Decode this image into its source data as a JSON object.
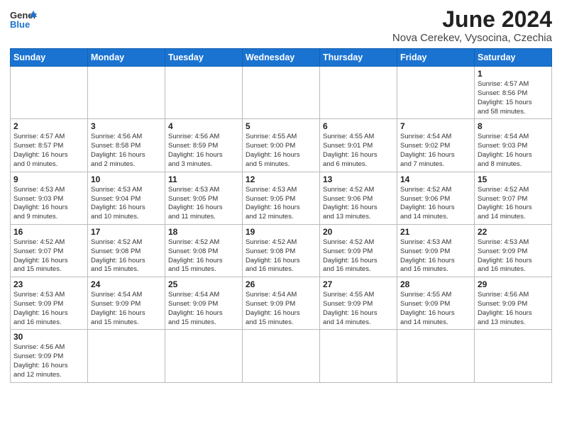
{
  "header": {
    "logo_general": "General",
    "logo_blue": "Blue",
    "month_title": "June 2024",
    "location": "Nova Cerekev, Vysocina, Czechia"
  },
  "days_of_week": [
    "Sunday",
    "Monday",
    "Tuesday",
    "Wednesday",
    "Thursday",
    "Friday",
    "Saturday"
  ],
  "weeks": [
    [
      {
        "day": "",
        "info": "",
        "empty": true
      },
      {
        "day": "",
        "info": "",
        "empty": true
      },
      {
        "day": "",
        "info": "",
        "empty": true
      },
      {
        "day": "",
        "info": "",
        "empty": true
      },
      {
        "day": "",
        "info": "",
        "empty": true
      },
      {
        "day": "",
        "info": "",
        "empty": true
      },
      {
        "day": "1",
        "info": "Sunrise: 4:57 AM\nSunset: 8:56 PM\nDaylight: 15 hours\nand 58 minutes.",
        "empty": false
      }
    ],
    [
      {
        "day": "2",
        "info": "Sunrise: 4:57 AM\nSunset: 8:57 PM\nDaylight: 16 hours\nand 0 minutes.",
        "empty": false
      },
      {
        "day": "3",
        "info": "Sunrise: 4:56 AM\nSunset: 8:58 PM\nDaylight: 16 hours\nand 2 minutes.",
        "empty": false
      },
      {
        "day": "4",
        "info": "Sunrise: 4:56 AM\nSunset: 8:59 PM\nDaylight: 16 hours\nand 3 minutes.",
        "empty": false
      },
      {
        "day": "5",
        "info": "Sunrise: 4:55 AM\nSunset: 9:00 PM\nDaylight: 16 hours\nand 5 minutes.",
        "empty": false
      },
      {
        "day": "6",
        "info": "Sunrise: 4:55 AM\nSunset: 9:01 PM\nDaylight: 16 hours\nand 6 minutes.",
        "empty": false
      },
      {
        "day": "7",
        "info": "Sunrise: 4:54 AM\nSunset: 9:02 PM\nDaylight: 16 hours\nand 7 minutes.",
        "empty": false
      },
      {
        "day": "8",
        "info": "Sunrise: 4:54 AM\nSunset: 9:03 PM\nDaylight: 16 hours\nand 8 minutes.",
        "empty": false
      }
    ],
    [
      {
        "day": "9",
        "info": "Sunrise: 4:53 AM\nSunset: 9:03 PM\nDaylight: 16 hours\nand 9 minutes.",
        "empty": false
      },
      {
        "day": "10",
        "info": "Sunrise: 4:53 AM\nSunset: 9:04 PM\nDaylight: 16 hours\nand 10 minutes.",
        "empty": false
      },
      {
        "day": "11",
        "info": "Sunrise: 4:53 AM\nSunset: 9:05 PM\nDaylight: 16 hours\nand 11 minutes.",
        "empty": false
      },
      {
        "day": "12",
        "info": "Sunrise: 4:53 AM\nSunset: 9:05 PM\nDaylight: 16 hours\nand 12 minutes.",
        "empty": false
      },
      {
        "day": "13",
        "info": "Sunrise: 4:52 AM\nSunset: 9:06 PM\nDaylight: 16 hours\nand 13 minutes.",
        "empty": false
      },
      {
        "day": "14",
        "info": "Sunrise: 4:52 AM\nSunset: 9:06 PM\nDaylight: 16 hours\nand 14 minutes.",
        "empty": false
      },
      {
        "day": "15",
        "info": "Sunrise: 4:52 AM\nSunset: 9:07 PM\nDaylight: 16 hours\nand 14 minutes.",
        "empty": false
      }
    ],
    [
      {
        "day": "16",
        "info": "Sunrise: 4:52 AM\nSunset: 9:07 PM\nDaylight: 16 hours\nand 15 minutes.",
        "empty": false
      },
      {
        "day": "17",
        "info": "Sunrise: 4:52 AM\nSunset: 9:08 PM\nDaylight: 16 hours\nand 15 minutes.",
        "empty": false
      },
      {
        "day": "18",
        "info": "Sunrise: 4:52 AM\nSunset: 9:08 PM\nDaylight: 16 hours\nand 15 minutes.",
        "empty": false
      },
      {
        "day": "19",
        "info": "Sunrise: 4:52 AM\nSunset: 9:08 PM\nDaylight: 16 hours\nand 16 minutes.",
        "empty": false
      },
      {
        "day": "20",
        "info": "Sunrise: 4:52 AM\nSunset: 9:09 PM\nDaylight: 16 hours\nand 16 minutes.",
        "empty": false
      },
      {
        "day": "21",
        "info": "Sunrise: 4:53 AM\nSunset: 9:09 PM\nDaylight: 16 hours\nand 16 minutes.",
        "empty": false
      },
      {
        "day": "22",
        "info": "Sunrise: 4:53 AM\nSunset: 9:09 PM\nDaylight: 16 hours\nand 16 minutes.",
        "empty": false
      }
    ],
    [
      {
        "day": "23",
        "info": "Sunrise: 4:53 AM\nSunset: 9:09 PM\nDaylight: 16 hours\nand 16 minutes.",
        "empty": false
      },
      {
        "day": "24",
        "info": "Sunrise: 4:54 AM\nSunset: 9:09 PM\nDaylight: 16 hours\nand 15 minutes.",
        "empty": false
      },
      {
        "day": "25",
        "info": "Sunrise: 4:54 AM\nSunset: 9:09 PM\nDaylight: 16 hours\nand 15 minutes.",
        "empty": false
      },
      {
        "day": "26",
        "info": "Sunrise: 4:54 AM\nSunset: 9:09 PM\nDaylight: 16 hours\nand 15 minutes.",
        "empty": false
      },
      {
        "day": "27",
        "info": "Sunrise: 4:55 AM\nSunset: 9:09 PM\nDaylight: 16 hours\nand 14 minutes.",
        "empty": false
      },
      {
        "day": "28",
        "info": "Sunrise: 4:55 AM\nSunset: 9:09 PM\nDaylight: 16 hours\nand 14 minutes.",
        "empty": false
      },
      {
        "day": "29",
        "info": "Sunrise: 4:56 AM\nSunset: 9:09 PM\nDaylight: 16 hours\nand 13 minutes.",
        "empty": false
      }
    ],
    [
      {
        "day": "30",
        "info": "Sunrise: 4:56 AM\nSunset: 9:09 PM\nDaylight: 16 hours\nand 12 minutes.",
        "empty": false
      },
      {
        "day": "",
        "info": "",
        "empty": true
      },
      {
        "day": "",
        "info": "",
        "empty": true
      },
      {
        "day": "",
        "info": "",
        "empty": true
      },
      {
        "day": "",
        "info": "",
        "empty": true
      },
      {
        "day": "",
        "info": "",
        "empty": true
      },
      {
        "day": "",
        "info": "",
        "empty": true
      }
    ]
  ]
}
